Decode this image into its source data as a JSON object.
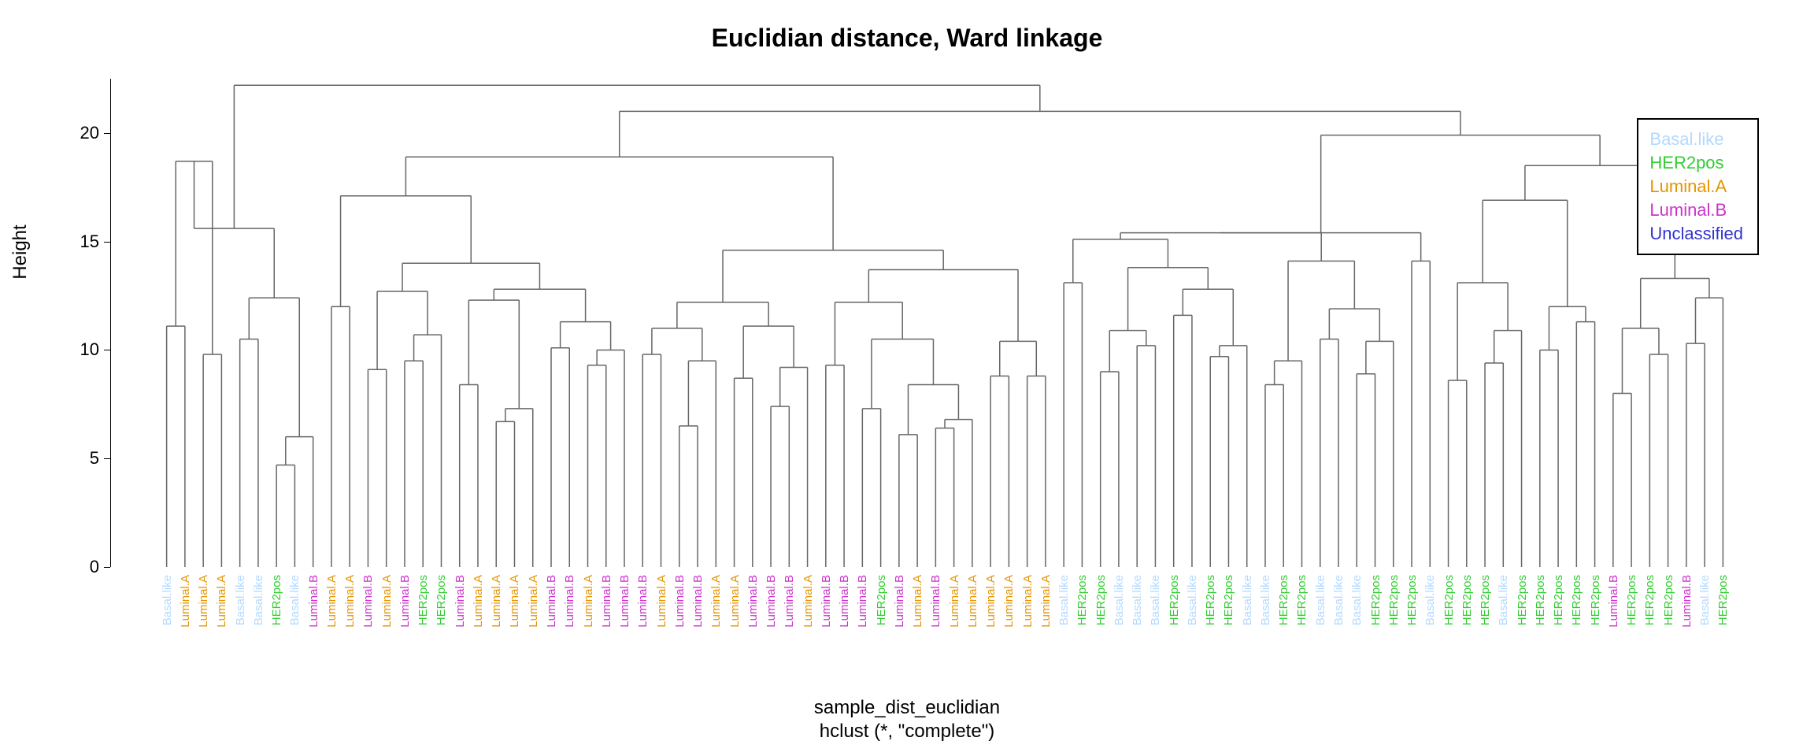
{
  "chart_data": {
    "type": "dendrogram",
    "title": "Euclidian distance, Ward linkage",
    "ylabel": "Height",
    "xlabel_1": "sample_dist_euclidian",
    "xlabel_2": "hclust (*, \"complete\")",
    "ylim": [
      0,
      22.5
    ],
    "yticks": [
      0,
      5,
      10,
      15,
      20
    ],
    "legend": [
      {
        "label": "Basal.like",
        "color": "#b3d9ff"
      },
      {
        "label": "HER2pos",
        "color": "#33cc33"
      },
      {
        "label": "Luminal.A",
        "color": "#e69500"
      },
      {
        "label": "Luminal.B",
        "color": "#cc33cc"
      },
      {
        "label": "Unclassified",
        "color": "#3333cc"
      }
    ],
    "class_colors": {
      "Basal.like": "#b3d9ff",
      "HER2pos": "#33cc33",
      "Luminal.A": "#e69500",
      "Luminal.B": "#cc33cc",
      "Unclassified": "#3333cc"
    },
    "leaves": [
      "Basal.like",
      "Luminal.A",
      "Luminal.A",
      "Luminal.A",
      "Basal.like",
      "Basal.like",
      "HER2pos",
      "Basal.like",
      "Luminal.B",
      "Luminal.A",
      "Luminal.A",
      "Luminal.B",
      "Luminal.A",
      "Luminal.B",
      "HER2pos",
      "HER2pos",
      "Luminal.B",
      "Luminal.A",
      "Luminal.A",
      "Luminal.A",
      "Luminal.A",
      "Luminal.B",
      "Luminal.B",
      "Luminal.A",
      "Luminal.B",
      "Luminal.B",
      "Luminal.B",
      "Luminal.A",
      "Luminal.B",
      "Luminal.B",
      "Luminal.A",
      "Luminal.A",
      "Luminal.B",
      "Luminal.B",
      "Luminal.B",
      "Luminal.A",
      "Luminal.B",
      "Luminal.B",
      "Luminal.B",
      "HER2pos",
      "Luminal.B",
      "Luminal.A",
      "Luminal.B",
      "Luminal.A",
      "Luminal.A",
      "Luminal.A",
      "Luminal.A",
      "Luminal.A",
      "Luminal.A",
      "Basal.like",
      "HER2pos",
      "HER2pos",
      "Basal.like",
      "Basal.like",
      "Basal.like",
      "HER2pos",
      "Basal.like",
      "HER2pos",
      "HER2pos",
      "Basal.like",
      "Basal.like",
      "HER2pos",
      "HER2pos",
      "Basal.like",
      "Basal.like",
      "Basal.like",
      "HER2pos",
      "HER2pos",
      "HER2pos",
      "Basal.like",
      "HER2pos",
      "HER2pos",
      "HER2pos",
      "Basal.like",
      "HER2pos",
      "HER2pos",
      "HER2pos",
      "HER2pos",
      "HER2pos",
      "Luminal.B",
      "HER2pos",
      "HER2pos",
      "HER2pos",
      "Luminal.B",
      "Basal.like",
      "HER2pos"
    ],
    "merges": [
      {
        "id": "m1",
        "l": 0,
        "r": 1,
        "h": 11.1
      },
      {
        "id": "m2",
        "l": 2,
        "r": 3,
        "h": 9.8
      },
      {
        "id": "m3",
        "l": "m1",
        "r": "m2",
        "h": 18.7
      },
      {
        "id": "m4",
        "l": 4,
        "r": 5,
        "h": 10.5
      },
      {
        "id": "m5",
        "l": 6,
        "r": 7,
        "h": 4.7
      },
      {
        "id": "m6",
        "l": "m5",
        "r": 8,
        "h": 6.0
      },
      {
        "id": "m7",
        "l": "m4",
        "r": "m6",
        "h": 12.4
      },
      {
        "id": "m8",
        "l": "m3",
        "r": "m7",
        "h": 15.6
      },
      {
        "id": "m10",
        "l": 9,
        "r": 10,
        "h": 12.0
      },
      {
        "id": "m11",
        "l": 11,
        "r": 12,
        "h": 9.1
      },
      {
        "id": "m12",
        "l": 13,
        "r": 14,
        "h": 9.5
      },
      {
        "id": "m13",
        "l": "m12",
        "r": 15,
        "h": 10.7
      },
      {
        "id": "m14",
        "l": "m11",
        "r": "m13",
        "h": 12.7
      },
      {
        "id": "m15",
        "l": 16,
        "r": 17,
        "h": 8.4
      },
      {
        "id": "m16",
        "l": 18,
        "r": 19,
        "h": 6.7
      },
      {
        "id": "m17",
        "l": "m16",
        "r": 20,
        "h": 7.3
      },
      {
        "id": "m18",
        "l": "m15",
        "r": "m17",
        "h": 12.3
      },
      {
        "id": "m19",
        "l": 21,
        "r": 22,
        "h": 10.1
      },
      {
        "id": "m20",
        "l": 23,
        "r": 24,
        "h": 9.3
      },
      {
        "id": "m21",
        "l": "m20",
        "r": 25,
        "h": 10.0
      },
      {
        "id": "m22",
        "l": "m19",
        "r": "m21",
        "h": 11.3
      },
      {
        "id": "m23",
        "l": "m18",
        "r": "m22",
        "h": 12.8
      },
      {
        "id": "m24",
        "l": "m14",
        "r": "m23",
        "h": 14.0
      },
      {
        "id": "m25",
        "l": "m10",
        "r": "m24",
        "h": 17.1
      },
      {
        "id": "m30",
        "l": 26,
        "r": 27,
        "h": 9.8
      },
      {
        "id": "m31",
        "l": 28,
        "r": 29,
        "h": 6.5
      },
      {
        "id": "m32",
        "l": "m31",
        "r": 30,
        "h": 9.5
      },
      {
        "id": "m33",
        "l": "m30",
        "r": "m32",
        "h": 11.0
      },
      {
        "id": "m34",
        "l": 31,
        "r": 32,
        "h": 8.7
      },
      {
        "id": "m35",
        "l": 33,
        "r": 34,
        "h": 7.4
      },
      {
        "id": "m36",
        "l": "m35",
        "r": 35,
        "h": 9.2
      },
      {
        "id": "m37",
        "l": "m34",
        "r": "m36",
        "h": 11.1
      },
      {
        "id": "m38",
        "l": "m33",
        "r": "m37",
        "h": 12.2
      },
      {
        "id": "m39",
        "l": 36,
        "r": 37,
        "h": 9.3
      },
      {
        "id": "m40",
        "l": 38,
        "r": 39,
        "h": 7.3
      },
      {
        "id": "m41",
        "l": 40,
        "r": 41,
        "h": 6.1
      },
      {
        "id": "m42",
        "l": 42,
        "r": 43,
        "h": 6.4
      },
      {
        "id": "m43",
        "l": "m42",
        "r": 44,
        "h": 6.8
      },
      {
        "id": "m44",
        "l": "m41",
        "r": "m43",
        "h": 8.4
      },
      {
        "id": "m45",
        "l": "m40",
        "r": "m44",
        "h": 10.5
      },
      {
        "id": "m46",
        "l": "m39",
        "r": "m45",
        "h": 12.2
      },
      {
        "id": "m47",
        "l": 45,
        "r": 46,
        "h": 8.8
      },
      {
        "id": "m48",
        "l": 47,
        "r": 48,
        "h": 8.8
      },
      {
        "id": "m49",
        "l": "m47",
        "r": "m48",
        "h": 10.4
      },
      {
        "id": "m50",
        "l": "m46",
        "r": "m49",
        "h": 13.7
      },
      {
        "id": "m51",
        "l": "m38",
        "r": "m50",
        "h": 14.6
      },
      {
        "id": "m52",
        "l": "m25",
        "r": "m51",
        "h": 18.9
      },
      {
        "id": "m60",
        "l": 49,
        "r": 50,
        "h": 13.1
      },
      {
        "id": "m61",
        "l": 51,
        "r": 52,
        "h": 9.0
      },
      {
        "id": "m62",
        "l": 53,
        "r": 54,
        "h": 10.2
      },
      {
        "id": "m63",
        "l": "m61",
        "r": "m62",
        "h": 10.9
      },
      {
        "id": "m64",
        "l": 55,
        "r": 56,
        "h": 11.6
      },
      {
        "id": "m65",
        "l": 57,
        "r": 58,
        "h": 9.7
      },
      {
        "id": "m66",
        "l": "m65",
        "r": 59,
        "h": 10.2
      },
      {
        "id": "m67",
        "l": "m64",
        "r": "m66",
        "h": 12.8
      },
      {
        "id": "m68",
        "l": "m63",
        "r": "m67",
        "h": 13.8
      },
      {
        "id": "m69",
        "l": "m60",
        "r": "m68",
        "h": 15.1
      },
      {
        "id": "m70",
        "l": 60,
        "r": 61,
        "h": 8.4
      },
      {
        "id": "m71",
        "l": "m70",
        "r": 62,
        "h": 9.5
      },
      {
        "id": "m72",
        "l": 63,
        "r": 64,
        "h": 10.5
      },
      {
        "id": "m73",
        "l": 65,
        "r": 66,
        "h": 8.9
      },
      {
        "id": "m74",
        "l": "m73",
        "r": 67,
        "h": 10.4
      },
      {
        "id": "m75",
        "l": "m72",
        "r": "m74",
        "h": 11.9
      },
      {
        "id": "m76",
        "l": "m71",
        "r": "m75",
        "h": 14.1
      },
      {
        "id": "m77",
        "l": "m69",
        "r": "m76",
        "h": 15.4
      },
      {
        "id": "m78",
        "l": 68,
        "r": 69,
        "h": 14.1
      },
      {
        "id": "m79",
        "l": "m77",
        "r": "m78",
        "h": 15.4
      },
      {
        "id": "m80",
        "l": 70,
        "r": 71,
        "h": 8.6
      },
      {
        "id": "m81",
        "l": 72,
        "r": 73,
        "h": 9.4
      },
      {
        "id": "m82",
        "l": "m81",
        "r": 74,
        "h": 10.9
      },
      {
        "id": "m83",
        "l": "m80",
        "r": "m82",
        "h": 13.1
      },
      {
        "id": "m84",
        "l": 75,
        "r": 76,
        "h": 10.0
      },
      {
        "id": "m85",
        "l": 77,
        "r": 78,
        "h": 11.3
      },
      {
        "id": "m86",
        "l": "m84",
        "r": "m85",
        "h": 12.0
      },
      {
        "id": "m87",
        "l": "m83",
        "r": "m86",
        "h": 16.9
      },
      {
        "id": "m88",
        "l": 79,
        "r": 80,
        "h": 8.0
      },
      {
        "id": "m89",
        "l": 81,
        "r": 82,
        "h": 9.8
      },
      {
        "id": "m90",
        "l": "m88",
        "r": "m89",
        "h": 11.0
      },
      {
        "id": "m91",
        "l": 83,
        "r": 84,
        "h": 10.3
      },
      {
        "id": "m92",
        "l": "m91",
        "r": 85,
        "h": 12.4
      },
      {
        "id": "m93",
        "l": "m90",
        "r": "m92",
        "h": 13.3
      },
      {
        "id": "m94",
        "l": "m87",
        "r": "m93",
        "h": 18.5
      },
      {
        "id": "m95",
        "l": "m79",
        "r": "m94",
        "h": 19.9
      },
      {
        "id": "m96",
        "l": "m52",
        "r": "m95",
        "h": 21.0
      },
      {
        "id": "m97",
        "l": "m8",
        "r": "m96",
        "h": 22.2
      }
    ]
  }
}
